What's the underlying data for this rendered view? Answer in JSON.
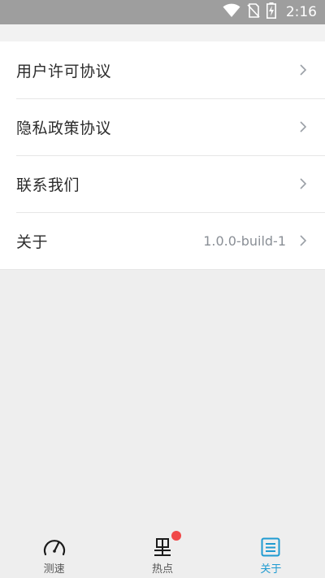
{
  "status_bar": {
    "time": "2:16",
    "icons": [
      "wifi-icon",
      "no-sim-icon",
      "battery-charging-icon"
    ]
  },
  "settings": {
    "items": [
      {
        "label": "用户许可协议",
        "value": "",
        "icon": "chevron-right-icon"
      },
      {
        "label": "隐私政策协议",
        "value": "",
        "icon": "chevron-right-icon"
      },
      {
        "label": "联系我们",
        "value": "",
        "icon": "chevron-right-icon"
      },
      {
        "label": "关于",
        "value": "1.0.0-build-1",
        "icon": "chevron-right-icon"
      }
    ]
  },
  "bottom_nav": {
    "tabs": [
      {
        "label": "测速",
        "icon": "speedometer-icon",
        "active": false
      },
      {
        "label": "热点",
        "icon": "hotspot-icon",
        "active": false,
        "badge": true
      },
      {
        "label": "关于",
        "icon": "document-list-icon",
        "active": true
      }
    ]
  },
  "colors": {
    "status_bar_bg": "#9e9e9e",
    "page_bg": "#eeeeee",
    "list_bg": "#ffffff",
    "accent": "#1f9bd1",
    "badge": "#f04848"
  }
}
